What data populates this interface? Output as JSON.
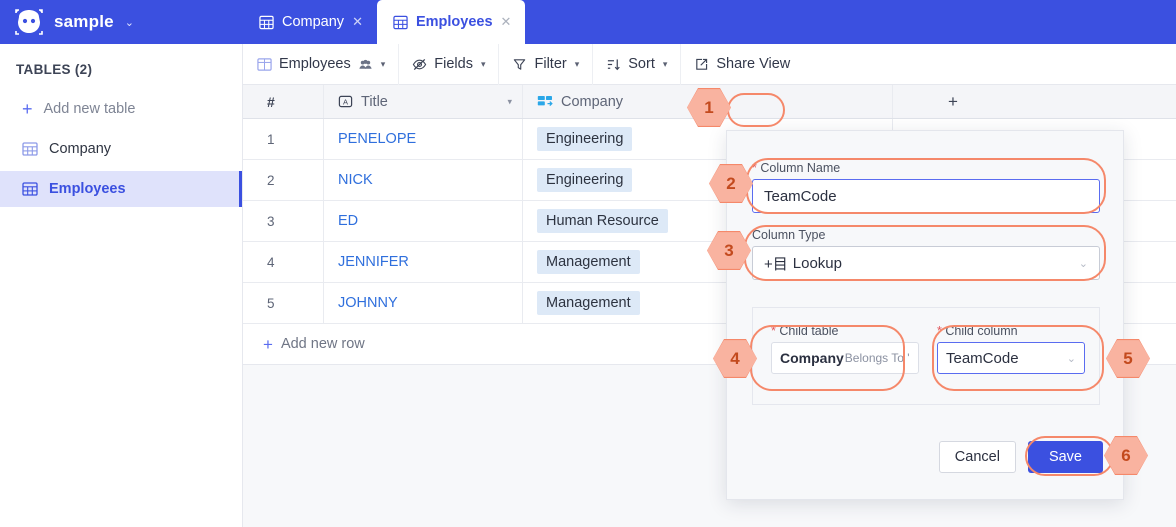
{
  "app": {
    "brand_name": "sample",
    "brand_caret": "⌄",
    "logo_icon": "robot-logo-icon",
    "accent_blue": "#3b50e0",
    "annotation_orange": "#f5886a",
    "hex_fill": "#f9b3a0",
    "hex_text": "#c34a1e"
  },
  "tabs": [
    {
      "label": "Company",
      "icon": "grid-icon",
      "close": "✕",
      "active": false
    },
    {
      "label": "Employees",
      "icon": "grid-icon",
      "close": "✕",
      "active": true
    }
  ],
  "sidebar": {
    "heading": "TABLES (2)",
    "add_new_table": {
      "label": "Add new table",
      "icon": "plus-icon"
    },
    "items": [
      {
        "label": "Company",
        "icon": "grid-icon",
        "selected": false
      },
      {
        "label": "Employees",
        "icon": "grid-icon",
        "selected": true
      }
    ]
  },
  "toolbar": [
    {
      "label": "Employees",
      "icon": "grid-icon",
      "extra_icon": "people-icon",
      "caret": "▾"
    },
    {
      "label": "Fields",
      "icon": "eye-slash-icon",
      "caret": "▾"
    },
    {
      "label": "Filter",
      "icon": "funnel-icon",
      "caret": "▾"
    },
    {
      "label": "Sort",
      "icon": "sort-icon",
      "caret": "▾"
    },
    {
      "label": "Share View",
      "icon": "external-link-icon"
    }
  ],
  "table": {
    "columns": [
      {
        "label": "#",
        "icon": null
      },
      {
        "label": "Title",
        "icon": "text-field-icon",
        "caret": "▾"
      },
      {
        "label": "Company",
        "icon": "link-to-record-icon"
      }
    ],
    "add_column_button": "+",
    "rows": [
      {
        "num": "1",
        "title": "PENELOPE",
        "company": "Engineering"
      },
      {
        "num": "2",
        "title": "NICK",
        "company": "Engineering"
      },
      {
        "num": "3",
        "title": "ED",
        "company": "Human Resource"
      },
      {
        "num": "4",
        "title": "JENNIFER",
        "company": "Management"
      },
      {
        "num": "5",
        "title": "JOHNNY",
        "company": "Management"
      }
    ],
    "add_new_row": {
      "label": "Add new row",
      "icon": "plus-icon"
    }
  },
  "modal": {
    "column_name": {
      "label": "Column Name",
      "required_marker": "*",
      "value": "TeamCode"
    },
    "column_type": {
      "label": "Column Type",
      "value": "Lookup",
      "value_icon": "+目",
      "caret": "⌄"
    },
    "child_table": {
      "label": "Child table",
      "required_marker": "*",
      "value_strong": "Company",
      "value_sub": "Belongs To 'C"
    },
    "child_column": {
      "label": "Child column",
      "required_marker": "*",
      "value": "TeamCode",
      "caret": "⌄"
    },
    "cancel_label": "Cancel",
    "save_label": "Save"
  },
  "annotations": [
    {
      "num": "1"
    },
    {
      "num": "2"
    },
    {
      "num": "3"
    },
    {
      "num": "4"
    },
    {
      "num": "5"
    },
    {
      "num": "6"
    }
  ]
}
